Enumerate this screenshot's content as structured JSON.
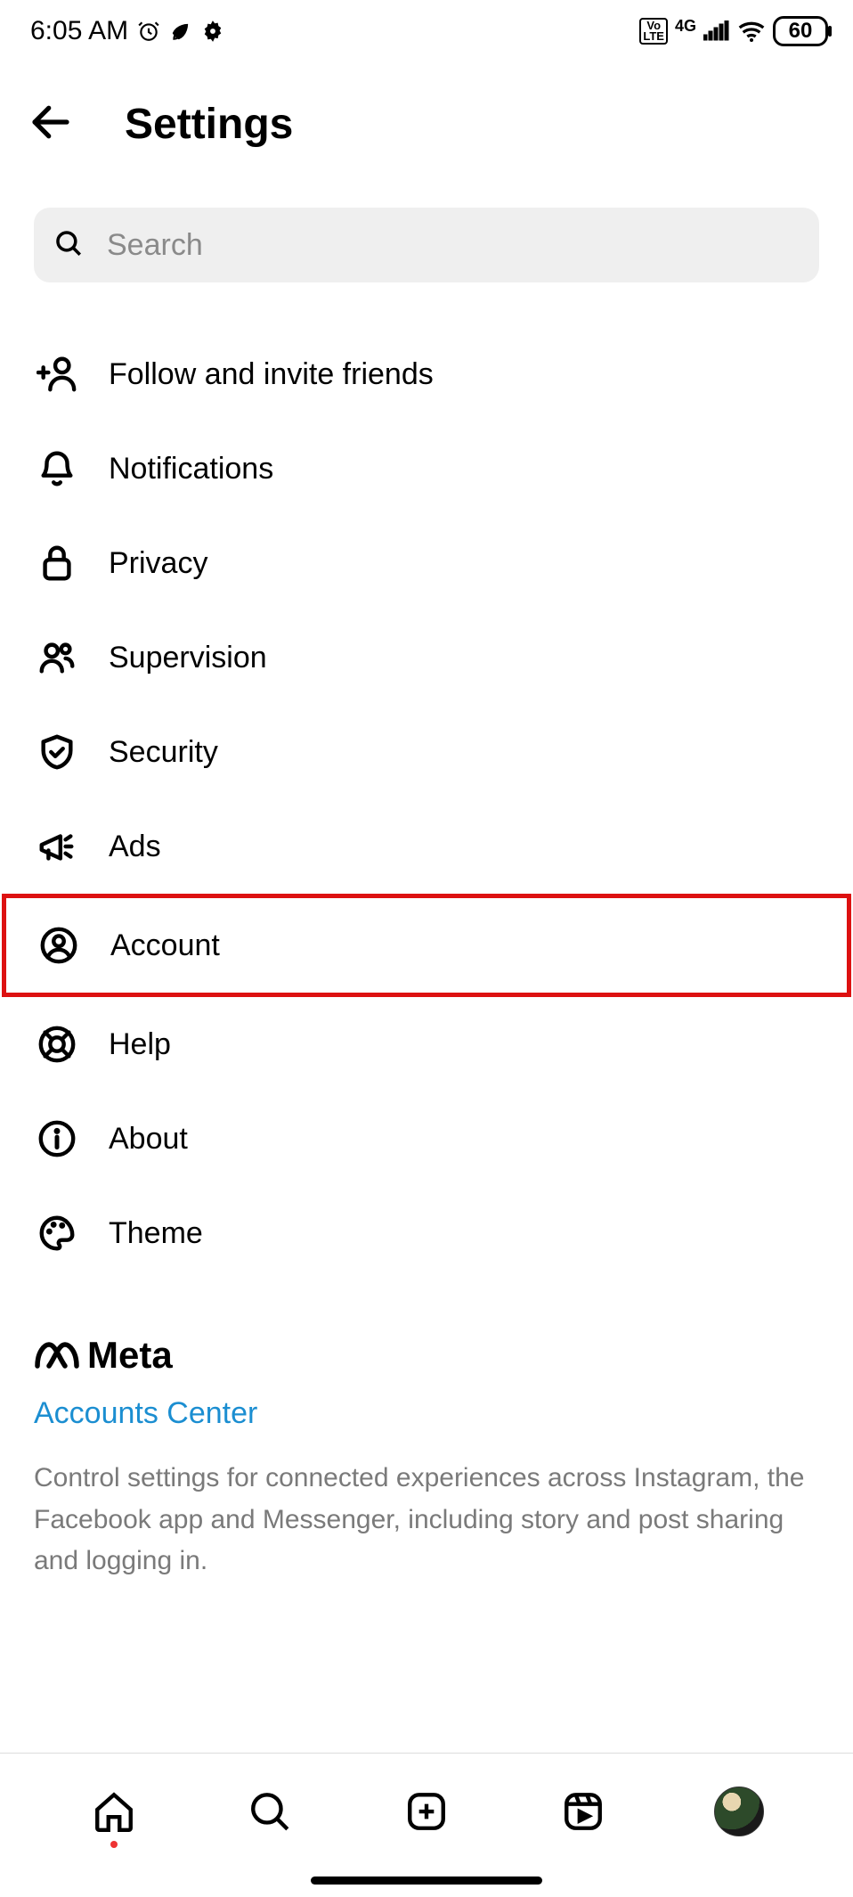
{
  "status": {
    "time": "6:05 AM",
    "network_type": "4G",
    "battery_pct": "60"
  },
  "header": {
    "title": "Settings"
  },
  "search": {
    "placeholder": "Search"
  },
  "menu": {
    "items": [
      {
        "key": "follow",
        "label": "Follow and invite friends",
        "icon": "person-plus-icon",
        "highlight": false
      },
      {
        "key": "notifications",
        "label": "Notifications",
        "icon": "bell-icon",
        "highlight": false
      },
      {
        "key": "privacy",
        "label": "Privacy",
        "icon": "lock-icon",
        "highlight": false
      },
      {
        "key": "supervision",
        "label": "Supervision",
        "icon": "people-icon",
        "highlight": false
      },
      {
        "key": "security",
        "label": "Security",
        "icon": "shield-check-icon",
        "highlight": false
      },
      {
        "key": "ads",
        "label": "Ads",
        "icon": "megaphone-icon",
        "highlight": false
      },
      {
        "key": "account",
        "label": "Account",
        "icon": "user-circle-icon",
        "highlight": true
      },
      {
        "key": "help",
        "label": "Help",
        "icon": "lifebuoy-icon",
        "highlight": false
      },
      {
        "key": "about",
        "label": "About",
        "icon": "info-circle-icon",
        "highlight": false
      },
      {
        "key": "theme",
        "label": "Theme",
        "icon": "palette-icon",
        "highlight": false
      }
    ]
  },
  "meta": {
    "brand": "Meta",
    "accounts_center_label": "Accounts Center",
    "description": "Control settings for connected experiences across Instagram, the Facebook app and Messenger, including story and post sharing and logging in."
  }
}
